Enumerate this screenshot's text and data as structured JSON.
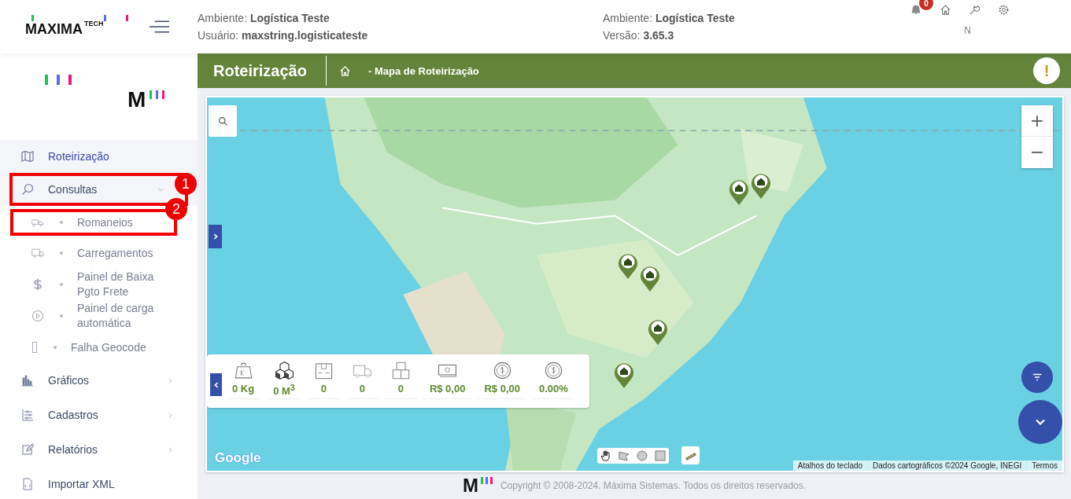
{
  "header": {
    "logo": {
      "name": "MAXIMA",
      "suffix": "TECH"
    },
    "info_left": [
      {
        "label": "Ambiente:",
        "value": "Logística Teste"
      },
      {
        "label": "Usuário:",
        "value": "maxstring.logisticateste"
      }
    ],
    "info_right": [
      {
        "label": "Ambiente:",
        "value": "Logística Teste"
      },
      {
        "label": "Versão:",
        "value": "3.65.3"
      }
    ],
    "notifications": {
      "count": "0"
    }
  },
  "sidebar": {
    "logo": "M",
    "items": [
      {
        "kind": "item",
        "label": "Roteirização",
        "selected": true,
        "expanded": false
      },
      {
        "kind": "group",
        "label": "Consultas",
        "selected": false,
        "expanded": true,
        "annotation": "1",
        "children": [
          {
            "label": "Romaneios",
            "annotation": "2"
          },
          {
            "label": "Carregamentos"
          },
          {
            "label": "Painel de Baixa Pgto Frete"
          },
          {
            "label": "Painel de carga automática"
          },
          {
            "label": "Falha Geocode"
          }
        ]
      },
      {
        "kind": "group",
        "label": "Gráficos",
        "selected": false,
        "expanded": false
      },
      {
        "kind": "group",
        "label": "Cadastros",
        "selected": false,
        "expanded": false
      },
      {
        "kind": "group",
        "label": "Relatórios",
        "selected": false,
        "expanded": false
      },
      {
        "kind": "item",
        "label": "Importar XML",
        "selected": false,
        "expanded": false
      }
    ]
  },
  "page_bar": {
    "title": "Roteirização",
    "breadcrumb": "- Mapa de Roteirização",
    "alert": "!"
  },
  "map": {
    "zoom": [
      "+",
      "−"
    ],
    "stats": [
      {
        "value": "0 Kg"
      },
      {
        "value": "0 M$^{3}$"
      },
      {
        "value": "0"
      },
      {
        "value": "0"
      },
      {
        "value": "0"
      },
      {
        "value": "R$ 0,00"
      },
      {
        "value": "R$ 0,00"
      },
      {
        "value": "0.00%"
      }
    ],
    "logo": "Google",
    "attribution": [
      "Atalhos do teclado",
      "Dados cartográficos ©2024 Google, INEGI",
      "Termos"
    ]
  },
  "footer": {
    "logo": "M",
    "text": "Copyright © 2008-2024. Máxima Sistemas. Todos os direitos reservados."
  }
}
